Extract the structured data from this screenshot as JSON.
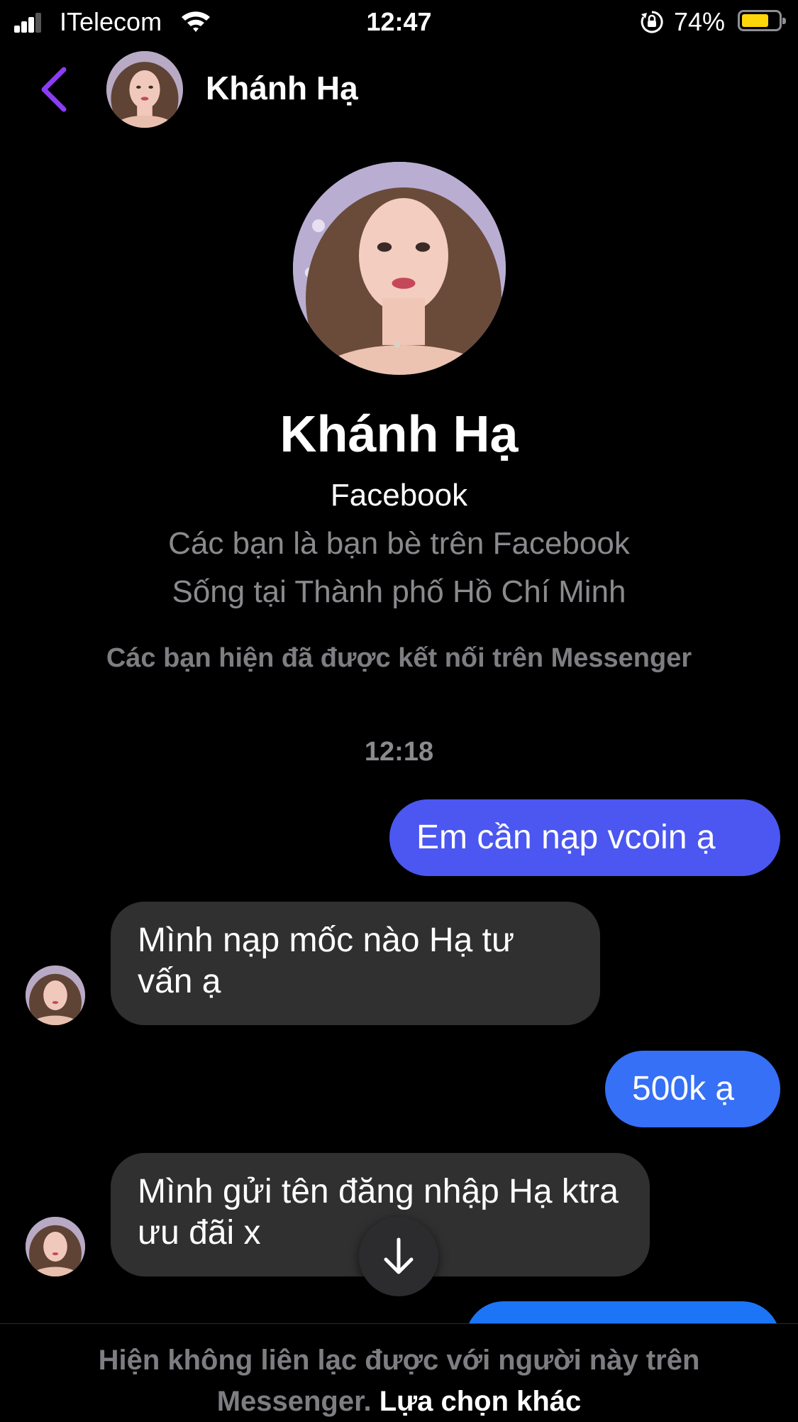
{
  "status_bar": {
    "carrier": "ITelecom",
    "time": "12:47",
    "battery_percent": "74%",
    "battery_level": 0.74,
    "icons": [
      "signal-icon",
      "wifi-icon",
      "orientation-lock-icon",
      "battery-icon"
    ]
  },
  "header": {
    "back_icon": "chevron-left-icon",
    "name": "Khánh Hạ"
  },
  "profile": {
    "name": "Khánh Hạ",
    "platform": "Facebook",
    "friends_line": "Các bạn là bạn bè trên Facebook",
    "location_line": "Sống tại Thành phố Hồ Chí Minh",
    "connected_note": "Các bạn hiện đã được kết nối trên Messenger"
  },
  "conversation": {
    "timestamp": "12:18",
    "messages": [
      {
        "from": "me",
        "text": "Em cần nạp vcoin ạ"
      },
      {
        "from": "them",
        "text": "Mình nạp mốc nào Hạ tư vấn ạ"
      },
      {
        "from": "me",
        "text": "500k ạ"
      },
      {
        "from": "them",
        "text": "Mình gửi tên đăng nhập Hạ ktra ưu đãi x"
      },
      {
        "from": "me",
        "text": ""
      }
    ]
  },
  "scroll_button": {
    "icon": "arrow-down-icon"
  },
  "notice": {
    "text": "Hiện không liên lạc được với người này trên Messenger.",
    "link": "Lựa chọn khác"
  },
  "colors": {
    "background": "#000000",
    "accent": "#8b3cf5",
    "bubble_in": "#303030",
    "bubble_out_1": "#4b57f0",
    "bubble_out_2": "#3670f6",
    "bubble_out_3": "#1c75f7",
    "muted_text": "#8a8a8e"
  }
}
